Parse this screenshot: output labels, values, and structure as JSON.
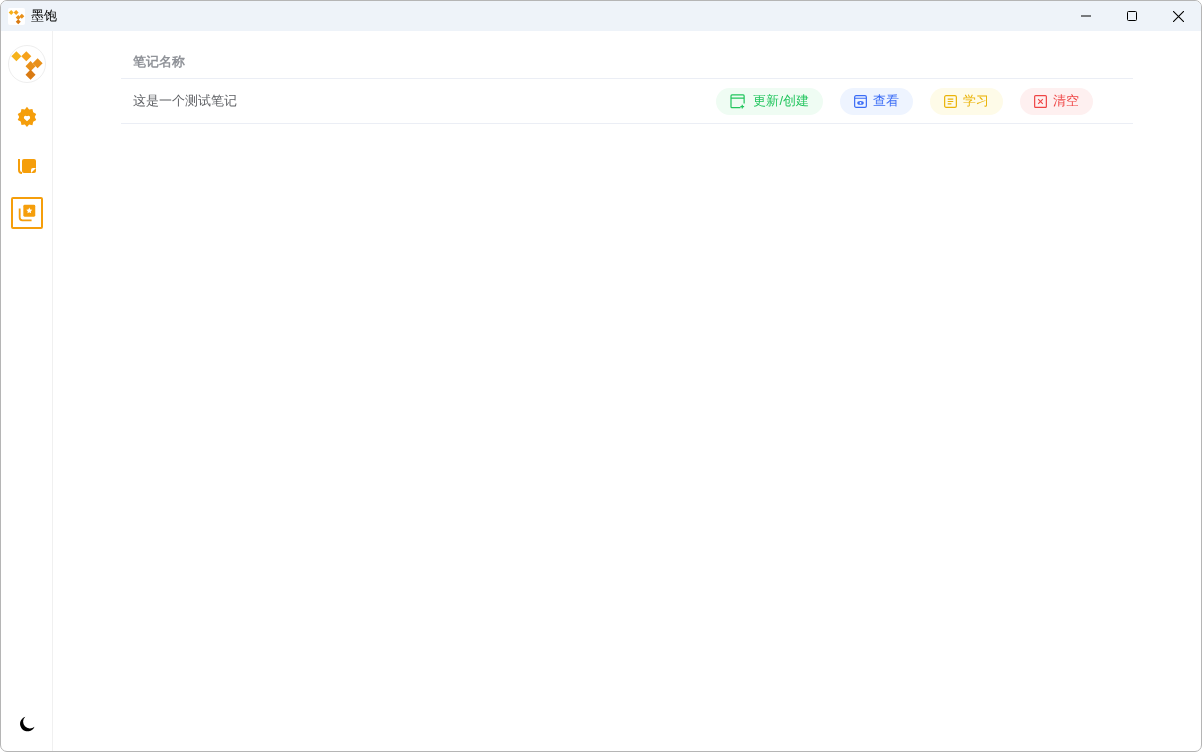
{
  "window": {
    "title": "墨饱"
  },
  "sidebar": {
    "items": [
      {
        "kind": "settings",
        "selected": false
      },
      {
        "kind": "notes",
        "selected": false
      },
      {
        "kind": "favorites",
        "selected": true
      }
    ]
  },
  "table": {
    "columns": [
      "笔记名称"
    ],
    "rows": [
      {
        "name": "这是一个测试笔记",
        "actions": [
          {
            "kind": "create",
            "label": "更新/创建"
          },
          {
            "kind": "view",
            "label": "查看"
          },
          {
            "kind": "study",
            "label": "学习"
          },
          {
            "kind": "clear",
            "label": "清空"
          }
        ]
      }
    ]
  }
}
